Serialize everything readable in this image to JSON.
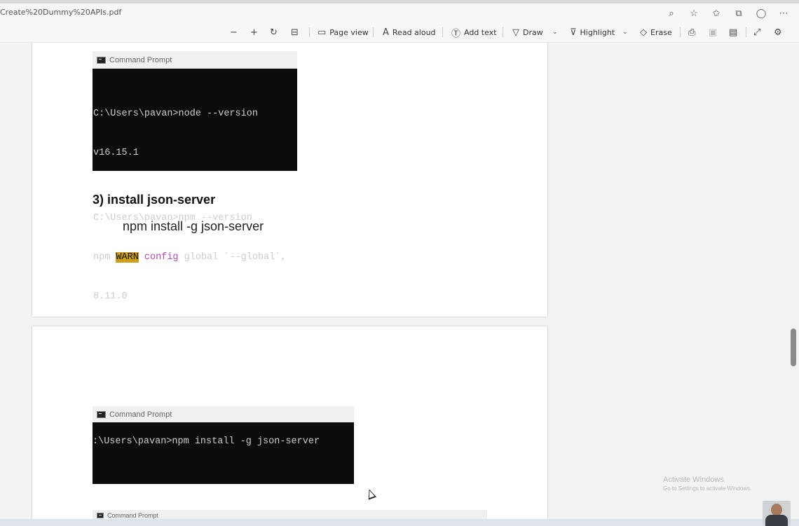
{
  "browser": {
    "url": "Create%20Dummy%20APIs.pdf"
  },
  "toolbar": {
    "page_view": "Page view",
    "read_aloud": "Read aloud",
    "add_text": "Add text",
    "draw": "Draw",
    "highlight": "Highlight",
    "erase": "Erase"
  },
  "page1": {
    "cmd_title": "Command Prompt",
    "lines": [
      "C:\\Users\\pavan>node --version",
      "v16.15.1",
      "",
      "C:\\Users\\pavan>npm --version"
    ],
    "warn_prefix": "npm ",
    "warn_word": "WARN",
    "config_word": "config",
    "warn_suffix": " global `--global`,",
    "npm_version": "8.11.0",
    "heading": "3) install json-server",
    "command": "npm install -g json-server"
  },
  "page2": {
    "cmd_title": "Command Prompt",
    "line": ":\\Users\\pavan>npm install -g json-server",
    "cmd_title_2": "Command Prompt"
  },
  "watermark": {
    "title": "Activate Windows",
    "sub": "Go to Settings to activate Windows."
  },
  "colors": {
    "warn_bg": "#cfa019",
    "config_fg": "#b24ab8",
    "terminal_bg": "#0c0c0c"
  }
}
